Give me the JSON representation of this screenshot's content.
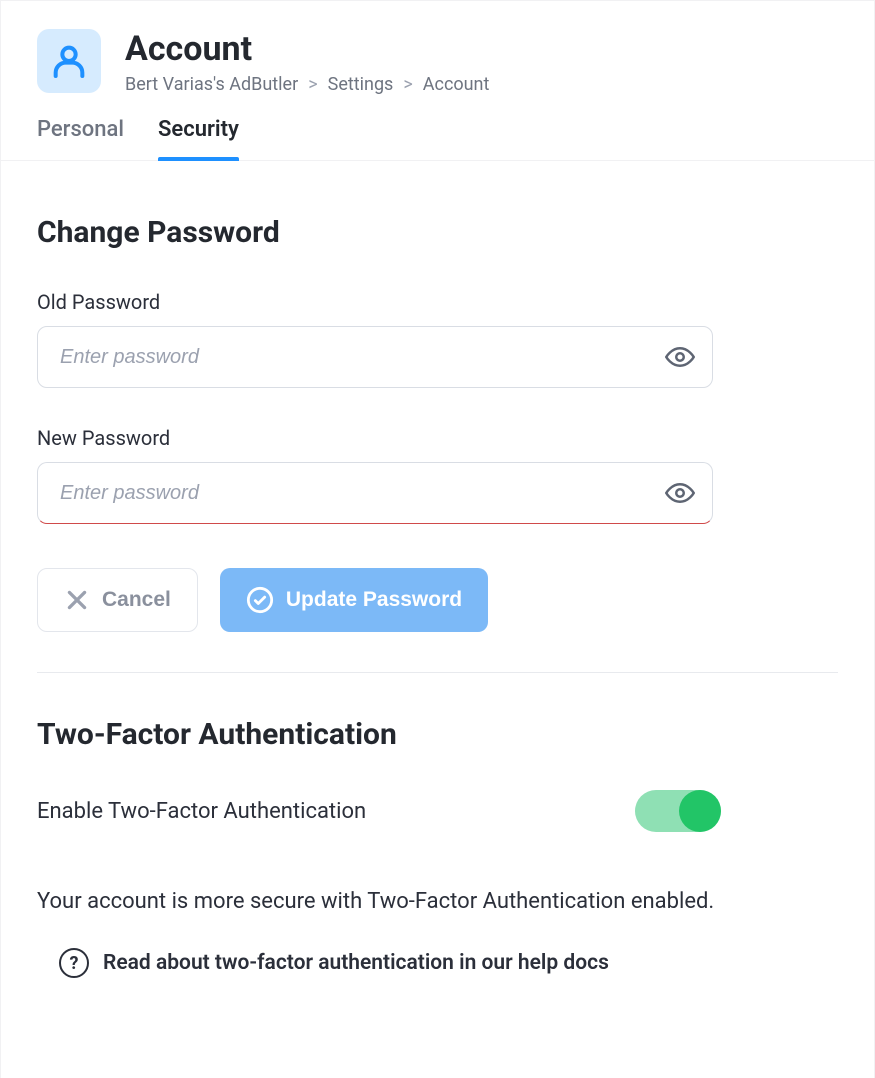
{
  "header": {
    "title": "Account",
    "breadcrumb": [
      "Bert Varias's AdButler",
      "Settings",
      "Account"
    ]
  },
  "tabs": [
    {
      "label": "Personal",
      "active": false
    },
    {
      "label": "Security",
      "active": true
    }
  ],
  "password_section": {
    "heading": "Change Password",
    "old_label": "Old Password",
    "old_placeholder": "Enter password",
    "new_label": "New Password",
    "new_placeholder": "Enter password",
    "cancel_label": "Cancel",
    "submit_label": "Update Password"
  },
  "tfa_section": {
    "heading": "Two-Factor Authentication",
    "toggle_label": "Enable Two-Factor Authentication",
    "toggle_on": true,
    "description": "Your account is more secure with Two-Factor Authentication enabled.",
    "help_text": "Read about two-factor authentication in our help docs"
  }
}
